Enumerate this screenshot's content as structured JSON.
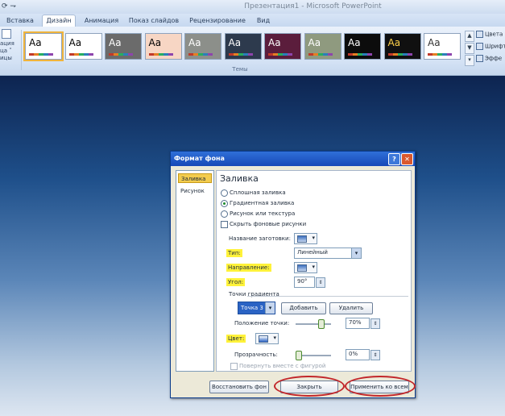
{
  "window": {
    "quick_access": "⟳ ⇁",
    "title": "Презентация1 - Microsoft PowerPoint"
  },
  "tabs": [
    "Вставка",
    "Дизайн",
    "Анимация",
    "Показ слайдов",
    "Рецензирование",
    "Вид"
  ],
  "active_tab": "Дизайн",
  "ribbon": {
    "left_group_lines": [
      "ация",
      "ца ˅",
      "ицы"
    ],
    "themes_group_label": "Темы",
    "theme_label": "Аа",
    "right_items": [
      "Цвета",
      "Шрифт",
      "Эффе"
    ]
  },
  "dialog": {
    "title": "Формат фона",
    "help_glyph": "?",
    "close_glyph": "✕",
    "nav_items": [
      "Заливка",
      "Рисунок"
    ],
    "heading": "Заливка",
    "fill_options": [
      "Сплошная заливка",
      "Градиентная заливка",
      "Рисунок или текстура"
    ],
    "selected_fill": "Градиентная заливка",
    "hide_background_label": "Скрыть фоновые рисунки",
    "preset_label": "Название заготовки:",
    "type_label": "Тип:",
    "type_value": "Линейный",
    "direction_label": "Направление:",
    "angle_label": "Угол:",
    "angle_value": "90°",
    "gradient_stops_label": "Точки градиента",
    "stop_value": "Точка 3",
    "add_button": "Добавить",
    "delete_button": "Удалить",
    "stop_position_label": "Положение точки:",
    "stop_position_value": "70%",
    "color_label": "Цвет:",
    "transparency_label": "Прозрачность:",
    "transparency_value": "0%",
    "rotate_with_shape_label": "Повернуть вместе с фигурой",
    "reset_button": "Восстановить фон",
    "close_button": "Закрыть",
    "apply_all_button": "Применить ко всем"
  },
  "colors": {
    "highlight": "#fff23a",
    "annotation_oval": "#c2262a",
    "dialog_title": "#1749b8",
    "selected_nav": "#f3cc4e"
  },
  "themes": [
    {
      "bg": "#ffffff",
      "fg": "#000000"
    },
    {
      "bg": "#ffffff",
      "fg": "#000000"
    },
    {
      "bg": "#6b6b6b",
      "fg": "#ffffff"
    },
    {
      "bg": "#f7d6c4",
      "fg": "#000000"
    },
    {
      "bg": "#8c8f8a",
      "fg": "#ffffff"
    },
    {
      "bg": "#2d3a4d",
      "fg": "#ffffff"
    },
    {
      "bg": "#5b1d3c",
      "fg": "#ffffff"
    },
    {
      "bg": "#8f9a7f",
      "fg": "#ffffff"
    },
    {
      "bg": "#0c0c0c",
      "fg": "#ffffff"
    },
    {
      "bg": "#101010",
      "fg": "#ffd24a"
    },
    {
      "bg": "#ffffff",
      "fg": "#333333"
    }
  ]
}
